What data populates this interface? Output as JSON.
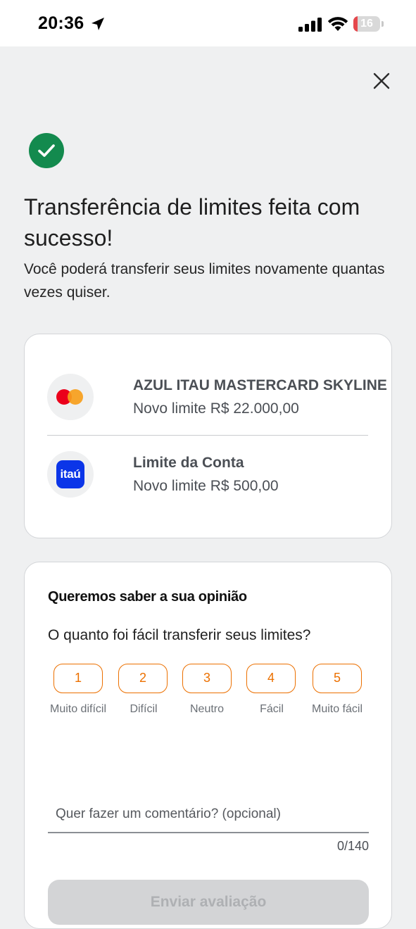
{
  "status_bar": {
    "time": "20:36",
    "battery": "16",
    "battery_level": 0.16,
    "icons": [
      "location-arrow-icon",
      "signal-icon",
      "wifi-icon",
      "battery-icon"
    ]
  },
  "header": {
    "close_icon": "close-icon"
  },
  "success": {
    "icon": "check-circle-icon",
    "color": "#138a4e",
    "title": "Transferência de limites feita com sucesso!",
    "subtitle": "Você poderá transferir seus limites novamente quantas vezes quiser."
  },
  "limits": [
    {
      "icon": "mastercard-icon",
      "name": "AZUL ITAU MASTERCARD SKYLINE",
      "detail": "Novo limite R$ 22.000,00"
    },
    {
      "icon": "itau-logo-icon",
      "logo_text": "itaú",
      "name": "Limite da Conta",
      "detail": "Novo limite R$ 500,00"
    }
  ],
  "feedback": {
    "title": "Queremos saber a sua opinião",
    "question": "O quanto foi fácil transferir seus limites?",
    "accent_color": "#ec7000",
    "ratings": [
      {
        "value": "1",
        "label": "Muito difícil"
      },
      {
        "value": "2",
        "label": "Difícil"
      },
      {
        "value": "3",
        "label": "Neutro"
      },
      {
        "value": "4",
        "label": "Fácil"
      },
      {
        "value": "5",
        "label": "Muito fácil"
      }
    ],
    "comment_placeholder": "Quer fazer um comentário? (opcional)",
    "counter": "0/140",
    "send_label": "Enviar avaliação"
  }
}
